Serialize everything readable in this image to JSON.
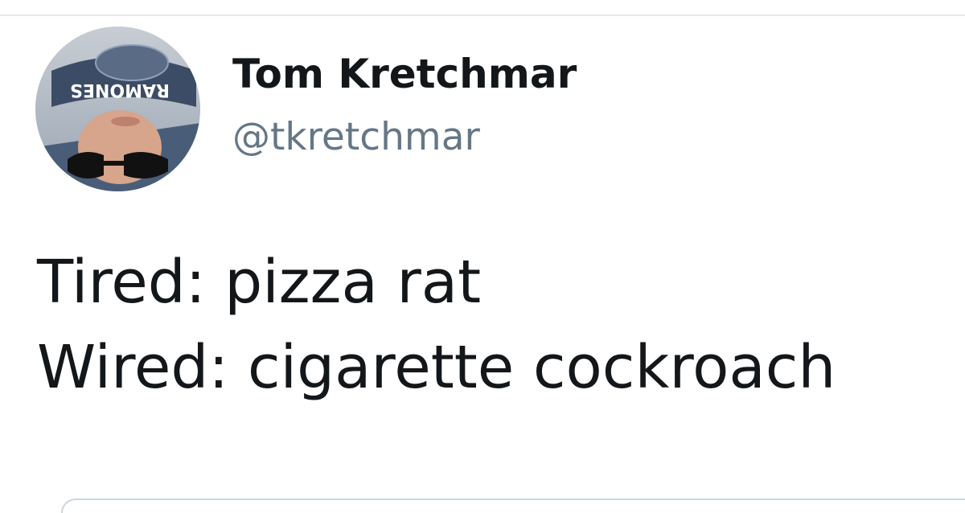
{
  "tweet": {
    "author": {
      "display_name": "Tom Kretchmar",
      "handle": "@tkretchmar",
      "avatar_icon": "profile-photo",
      "avatar_cap_text": "RAMONES"
    },
    "lines": [
      "Tired: pizza rat",
      "Wired: cigarette cockroach"
    ]
  },
  "colors": {
    "text_primary": "#14171a",
    "text_secondary": "#657786",
    "divider": "#e6ecf0",
    "card_border": "#ccd6dd"
  }
}
